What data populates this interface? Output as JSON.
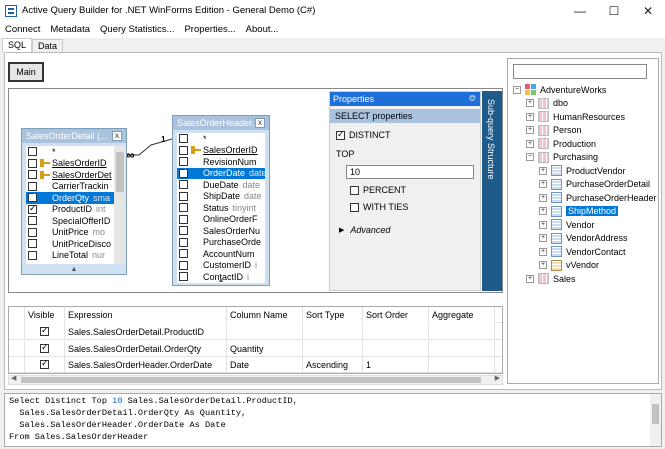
{
  "window": {
    "title": "Active Query Builder for .NET WinForms Edition - General Demo (C#)",
    "minimize_icon": "minimize-icon",
    "maximize_icon": "maximize-icon",
    "close_icon": "close-icon"
  },
  "menubar": [
    "Connect",
    "Metadata",
    "Query Statistics...",
    "Properties...",
    "About..."
  ],
  "tabs": [
    {
      "label": "SQL",
      "active": true
    },
    {
      "label": "Data",
      "active": false
    }
  ],
  "query_tabs": {
    "main": "Main"
  },
  "tables": [
    {
      "title": "SalesOrderDetail (...",
      "fields": [
        {
          "name": "*",
          "type": "",
          "checked": false,
          "key": false,
          "underline": false,
          "selected": false
        },
        {
          "name": "SalesOrderID",
          "type": "",
          "checked": false,
          "key": true,
          "underline": true,
          "selected": false
        },
        {
          "name": "SalesOrderDet",
          "type": "",
          "checked": false,
          "key": true,
          "underline": true,
          "selected": false
        },
        {
          "name": "CarrierTrackin",
          "type": "",
          "checked": false,
          "key": false,
          "underline": false,
          "selected": false
        },
        {
          "name": "OrderQty",
          "type": "sma",
          "checked": true,
          "key": false,
          "underline": false,
          "selected": true
        },
        {
          "name": "ProductID",
          "type": "int",
          "checked": true,
          "key": false,
          "underline": false,
          "selected": false
        },
        {
          "name": "SpecialOfferID",
          "type": "",
          "checked": false,
          "key": false,
          "underline": false,
          "selected": false
        },
        {
          "name": "UnitPrice",
          "type": "mo",
          "checked": false,
          "key": false,
          "underline": false,
          "selected": false
        },
        {
          "name": "UnitPriceDisco",
          "type": "",
          "checked": false,
          "key": false,
          "underline": false,
          "selected": false
        },
        {
          "name": "LineTotal",
          "type": "nur",
          "checked": false,
          "key": false,
          "underline": false,
          "selected": false
        }
      ]
    },
    {
      "title": "SalesOrderHeader...",
      "fields": [
        {
          "name": "*",
          "type": "",
          "checked": false,
          "key": false,
          "underline": false,
          "selected": false
        },
        {
          "name": "SalesOrderID",
          "type": "",
          "checked": false,
          "key": true,
          "underline": true,
          "selected": false
        },
        {
          "name": "RevisionNum",
          "type": "",
          "checked": false,
          "key": false,
          "underline": false,
          "selected": false
        },
        {
          "name": "OrderDate",
          "type": "date",
          "checked": true,
          "key": false,
          "underline": false,
          "selected": true
        },
        {
          "name": "DueDate",
          "type": "date",
          "checked": false,
          "key": false,
          "underline": false,
          "selected": false
        },
        {
          "name": "ShipDate",
          "type": "date",
          "checked": false,
          "key": false,
          "underline": false,
          "selected": false
        },
        {
          "name": "Status",
          "type": "tinyint",
          "checked": false,
          "key": false,
          "underline": false,
          "selected": false
        },
        {
          "name": "OnlineOrderF",
          "type": "",
          "checked": false,
          "key": false,
          "underline": false,
          "selected": false
        },
        {
          "name": "SalesOrderNu",
          "type": "",
          "checked": false,
          "key": false,
          "underline": false,
          "selected": false
        },
        {
          "name": "PurchaseOrde",
          "type": "",
          "checked": false,
          "key": false,
          "underline": false,
          "selected": false
        },
        {
          "name": "AccountNum",
          "type": "",
          "checked": false,
          "key": false,
          "underline": false,
          "selected": false
        },
        {
          "name": "CustomerID",
          "type": "i",
          "checked": false,
          "key": false,
          "underline": false,
          "selected": false
        },
        {
          "name": "ContactID",
          "type": "i",
          "checked": false,
          "key": false,
          "underline": false,
          "selected": false
        }
      ]
    }
  ],
  "link": {
    "left_card": "∞",
    "right_card": "1"
  },
  "properties": {
    "title": "Properties",
    "pin_icon": "pin-icon",
    "selected": "SELECT properties",
    "distinct_label": "DISTINCT",
    "distinct_checked": true,
    "top_label": "TOP",
    "top_value": "10",
    "percent_label": "PERCENT",
    "percent_checked": false,
    "withties_label": "WITH TIES",
    "withties_checked": false,
    "advanced_label": "Advanced",
    "advanced_icon": "triangle-right-icon"
  },
  "subquery_label": "Sub-query Structure",
  "grid": {
    "headers": [
      "Visible",
      "Expression",
      "Column Name",
      "Sort Type",
      "Sort Order",
      "Aggregate"
    ],
    "rows": [
      {
        "visible": true,
        "expression": "Sales.SalesOrderDetail.ProductID",
        "column_name": "",
        "sort_type": "",
        "sort_order": "",
        "aggregate": ""
      },
      {
        "visible": true,
        "expression": "Sales.SalesOrderDetail.OrderQty",
        "column_name": "Quantity",
        "sort_type": "",
        "sort_order": "",
        "aggregate": ""
      },
      {
        "visible": true,
        "expression": "Sales.SalesOrderHeader.OrderDate",
        "column_name": "Date",
        "sort_type": "Ascending",
        "sort_order": "1",
        "aggregate": ""
      }
    ]
  },
  "tree": {
    "search_placeholder": "",
    "nodes": [
      {
        "label": "AdventureWorks",
        "level": 0,
        "icon": "database-icon",
        "exp": "−",
        "selected": false
      },
      {
        "label": "dbo",
        "level": 1,
        "icon": "schema-icon",
        "exp": "+",
        "selected": false
      },
      {
        "label": "HumanResources",
        "level": 1,
        "icon": "schema-icon",
        "exp": "+",
        "selected": false
      },
      {
        "label": "Person",
        "level": 1,
        "icon": "schema-icon",
        "exp": "+",
        "selected": false
      },
      {
        "label": "Production",
        "level": 1,
        "icon": "schema-icon",
        "exp": "+",
        "selected": false
      },
      {
        "label": "Purchasing",
        "level": 1,
        "icon": "schema-icon",
        "exp": "−",
        "selected": false
      },
      {
        "label": "ProductVendor",
        "level": 2,
        "icon": "table-icon",
        "exp": "+",
        "selected": false
      },
      {
        "label": "PurchaseOrderDetail",
        "level": 2,
        "icon": "table-icon",
        "exp": "+",
        "selected": false
      },
      {
        "label": "PurchaseOrderHeader",
        "level": 2,
        "icon": "table-icon",
        "exp": "+",
        "selected": false
      },
      {
        "label": "ShipMethod",
        "level": 2,
        "icon": "table-icon",
        "exp": "+",
        "selected": true
      },
      {
        "label": "Vendor",
        "level": 2,
        "icon": "table-icon",
        "exp": "+",
        "selected": false
      },
      {
        "label": "VendorAddress",
        "level": 2,
        "icon": "table-icon",
        "exp": "+",
        "selected": false
      },
      {
        "label": "VendorContact",
        "level": 2,
        "icon": "table-icon",
        "exp": "+",
        "selected": false
      },
      {
        "label": "vVendor",
        "level": 2,
        "icon": "view-icon",
        "exp": "+",
        "selected": false
      },
      {
        "label": "Sales",
        "level": 1,
        "icon": "schema-icon",
        "exp": "+",
        "selected": false
      }
    ]
  },
  "sql": {
    "lines": [
      [
        "Select Distinct Top ",
        "10",
        " Sales.SalesOrderDetail.ProductID,"
      ],
      [
        "  Sales.SalesOrderDetail.OrderQty As Quantity,",
        "",
        ""
      ],
      [
        "  Sales.SalesOrderHeader.OrderDate As Date",
        "",
        ""
      ],
      [
        "From Sales.SalesOrderHeader",
        "",
        ""
      ]
    ]
  }
}
